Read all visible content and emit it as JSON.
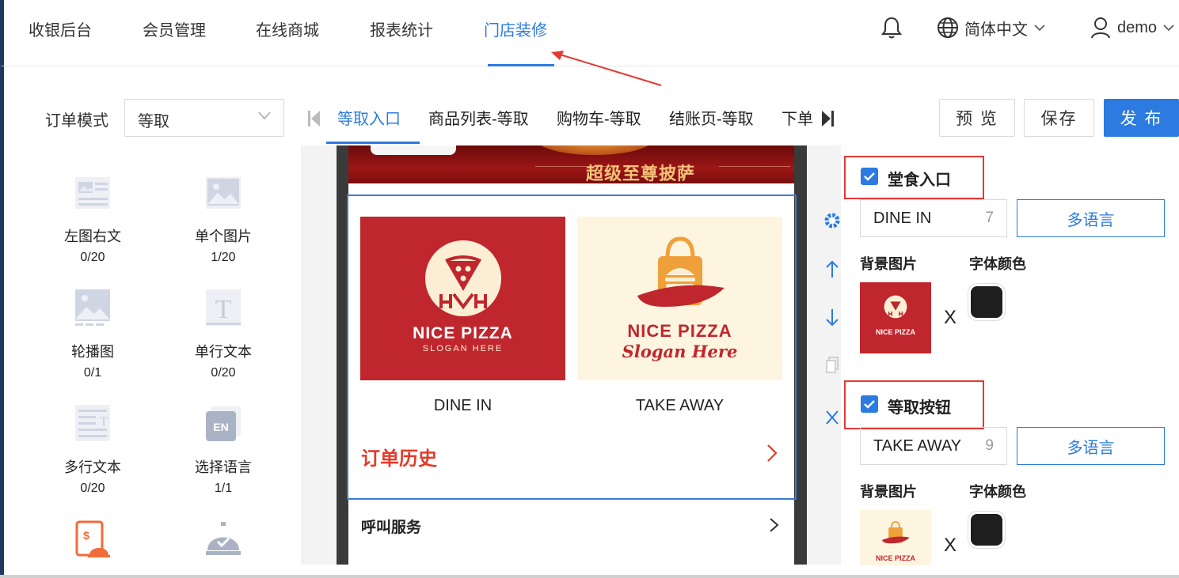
{
  "nav": {
    "items": [
      "收银后台",
      "会员管理",
      "在线商城",
      "报表统计",
      "门店装修"
    ],
    "active_index": 4,
    "language": "简体中文",
    "user": "demo"
  },
  "toolbar": {
    "order_mode_label": "订单模式",
    "order_mode_value": "等取",
    "tabs": [
      "等取入口",
      "商品列表-等取",
      "购物车-等取",
      "结账页-等取",
      "下单"
    ],
    "active_tab": 0,
    "preview": "预 览",
    "save": "保存",
    "publish": "发 布"
  },
  "components": [
    {
      "name": "左图右文",
      "count": "0/20",
      "icon": "image-text-icon"
    },
    {
      "name": "单个图片",
      "count": "1/20",
      "icon": "image-icon"
    },
    {
      "name": "轮播图",
      "count": "0/1",
      "icon": "carousel-icon"
    },
    {
      "name": "单行文本",
      "count": "0/20",
      "icon": "text-icon"
    },
    {
      "name": "多行文本",
      "count": "0/20",
      "icon": "multiline-text-icon"
    },
    {
      "name": "选择语言",
      "count": "1/1",
      "icon": "language-icon"
    }
  ],
  "preview": {
    "banner_text": "超级至尊披萨",
    "dine_in_label": "DINE IN",
    "take_away_label": "TAKE AWAY",
    "logo_text_1": "NICE PIZZA",
    "logo_slogan_1": "SLOGAN HERE",
    "logo_text_2": "NICE PIZZA",
    "logo_slogan_2": "Slogan Here",
    "history": "订单历史",
    "call_service": "呼叫服务"
  },
  "panel": {
    "sections": [
      {
        "title": "堂食入口",
        "value": "DINE IN",
        "count": "7",
        "lang_button": "多语言",
        "bg_label": "背景图片",
        "color_label": "字体颜色",
        "color": "#1e1e1e",
        "checked": true
      },
      {
        "title": "等取按钮",
        "value": "TAKE AWAY",
        "count": "9",
        "lang_button": "多语言",
        "bg_label": "背景图片",
        "color_label": "字体颜色",
        "color": "#1e1e1e",
        "checked": true
      }
    ],
    "remove_mark": "X"
  },
  "colors": {
    "accent": "#2d7be0",
    "red_card": "#c0262d",
    "cream_card": "#fdf5e0",
    "history": "#e23c2a",
    "annotation": "#e53935"
  }
}
